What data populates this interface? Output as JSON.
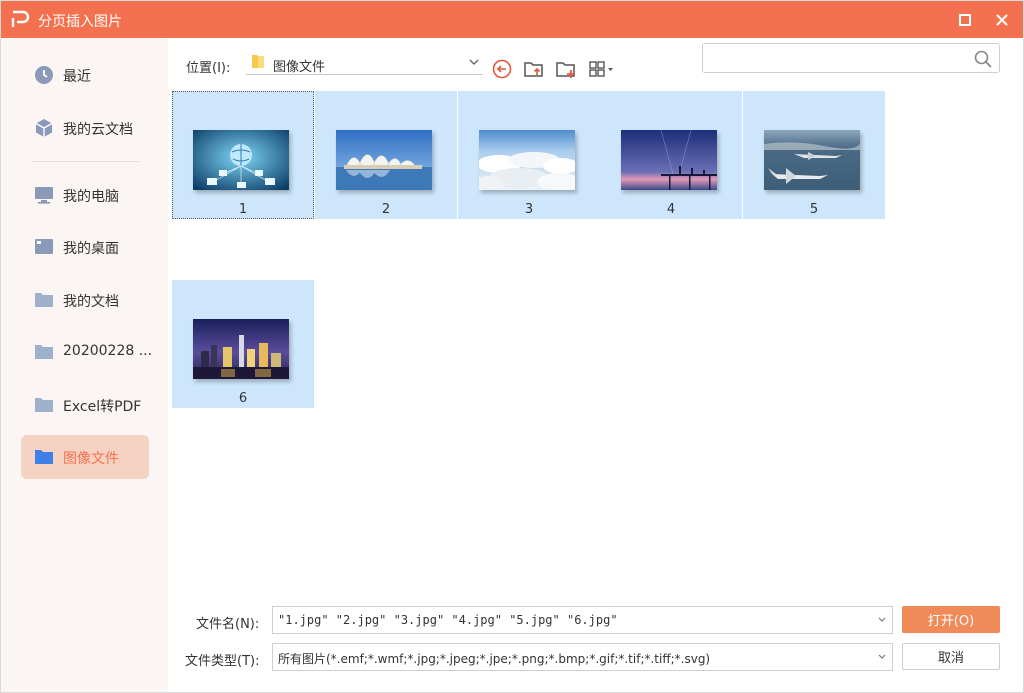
{
  "window": {
    "title": "分页插入图片",
    "accent_color": "#f4714f"
  },
  "sidebar": {
    "items": [
      {
        "label": "最近",
        "icon": "clock-icon"
      },
      {
        "label": "我的云文档",
        "icon": "cloud-cube-icon"
      },
      {
        "label": "我的电脑",
        "icon": "computer-icon"
      },
      {
        "label": "我的桌面",
        "icon": "desktop-icon"
      },
      {
        "label": "我的文档",
        "icon": "folder-icon"
      },
      {
        "label": "20200228 ...",
        "icon": "folder-icon"
      },
      {
        "label": "Excel转PDF",
        "icon": "folder-icon"
      },
      {
        "label": "图像文件",
        "icon": "folder-icon",
        "active": true
      }
    ]
  },
  "toolbar": {
    "location_label": "位置(I):",
    "location_value": "图像文件",
    "search_placeholder": ""
  },
  "files": [
    {
      "name": "1",
      "thumbnail": "globe-network-image"
    },
    {
      "name": "2",
      "thumbnail": "sydney-opera-house-image"
    },
    {
      "name": "3",
      "thumbnail": "clouds-image"
    },
    {
      "name": "4",
      "thumbnail": "pier-dusk-image"
    },
    {
      "name": "5",
      "thumbnail": "fighter-jets-image"
    },
    {
      "name": "6",
      "thumbnail": "city-skyline-night-image"
    }
  ],
  "footer": {
    "filename_label": "文件名(N):",
    "filename_value": "\"1.jpg\" \"2.jpg\" \"3.jpg\" \"4.jpg\" \"5.jpg\" \"6.jpg\"",
    "filetype_label": "文件类型(T):",
    "filetype_value": "所有图片(*.emf;*.wmf;*.jpg;*.jpeg;*.jpe;*.png;*.bmp;*.gif;*.tif;*.tiff;*.svg)",
    "open_label": "打开(O)",
    "cancel_label": "取消"
  }
}
